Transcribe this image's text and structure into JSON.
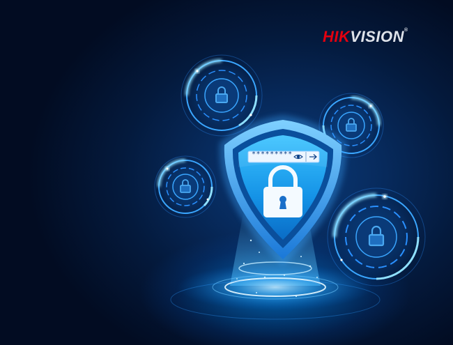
{
  "brand": {
    "part1": "HIK",
    "part2": "VISION",
    "registered": "®",
    "color_red": "#e3000f",
    "color_light": "#dfe3ea"
  },
  "password_field": {
    "masked_value": "*********",
    "reveal_icon": "eye-icon",
    "submit_icon": "arrow-right-icon"
  },
  "shield": {
    "icon": "padlock-icon"
  },
  "rings": {
    "icon": "padlock-icon",
    "count": 4
  },
  "colors": {
    "background": "#04122b",
    "glow": "#2aa8ff",
    "shield": "#1a8ee8"
  }
}
